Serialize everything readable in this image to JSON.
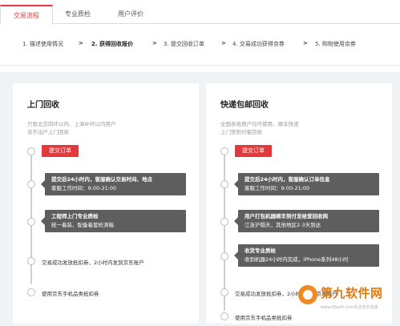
{
  "tabs": [
    {
      "label": "交易流程",
      "active": true
    },
    {
      "label": "专业质检",
      "active": false
    },
    {
      "label": "用户评价",
      "active": false
    }
  ],
  "steps": [
    {
      "label": "1. 描述使用情况",
      "active": false
    },
    {
      "label": "2. 获得回收报价",
      "active": true
    },
    {
      "label": "3. 提交回收订单",
      "active": false
    },
    {
      "label": "4. 交易成功获得京券",
      "active": false
    },
    {
      "label": "5. 购物使用京券",
      "active": false
    }
  ],
  "step_separator": ">",
  "left": {
    "title": "上门回收",
    "desc_line1": "只限北京四环以内、上海中环以内用户",
    "desc_line2": "足不出户上门回收",
    "submit_label": "提交订单",
    "box1_line1": "提交后24小时内，客服确认交易时间、地点",
    "box1_line2": "客服工作时间：9:00-21:00",
    "box2_line1": "工程师上门专业质检",
    "box2_line2": "统一着装、配备着套检测箱",
    "item3": "交易成功发放抵扣券，2小时内发到京东账户",
    "item4": "使用京东手机品类抵扣券"
  },
  "right": {
    "title": "快递包邮回收",
    "desc_line1": "全国各地用户均可使用，顺丰快递",
    "desc_line2": "上门快到付客回收",
    "submit_label": "提交订单",
    "box1_line1": "提交后24小时内，客服确认订单信息",
    "box1_line2": "客服工作时间：9:00-21:00",
    "box2_line1": "用户打包机器顺丰到付发给爱回收网",
    "box2_line2": "江浙沪隔天，其他地区2-3天到达",
    "box3_line1": "收货专业质检",
    "box3_line2": "收到机器24小时内完成，iPhone系列48小时",
    "item4": "交易成功发放抵扣券，2小时内发到京东账户",
    "item5": "使用京东手机品类抵扣券"
  },
  "watermark": {
    "title": "第九软件网",
    "sub": "www.d9soft.com专业安全高速"
  },
  "colors": {
    "accent": "#e4393c",
    "dark_box": "#5e5e5e",
    "background": "#f0f3f6"
  }
}
